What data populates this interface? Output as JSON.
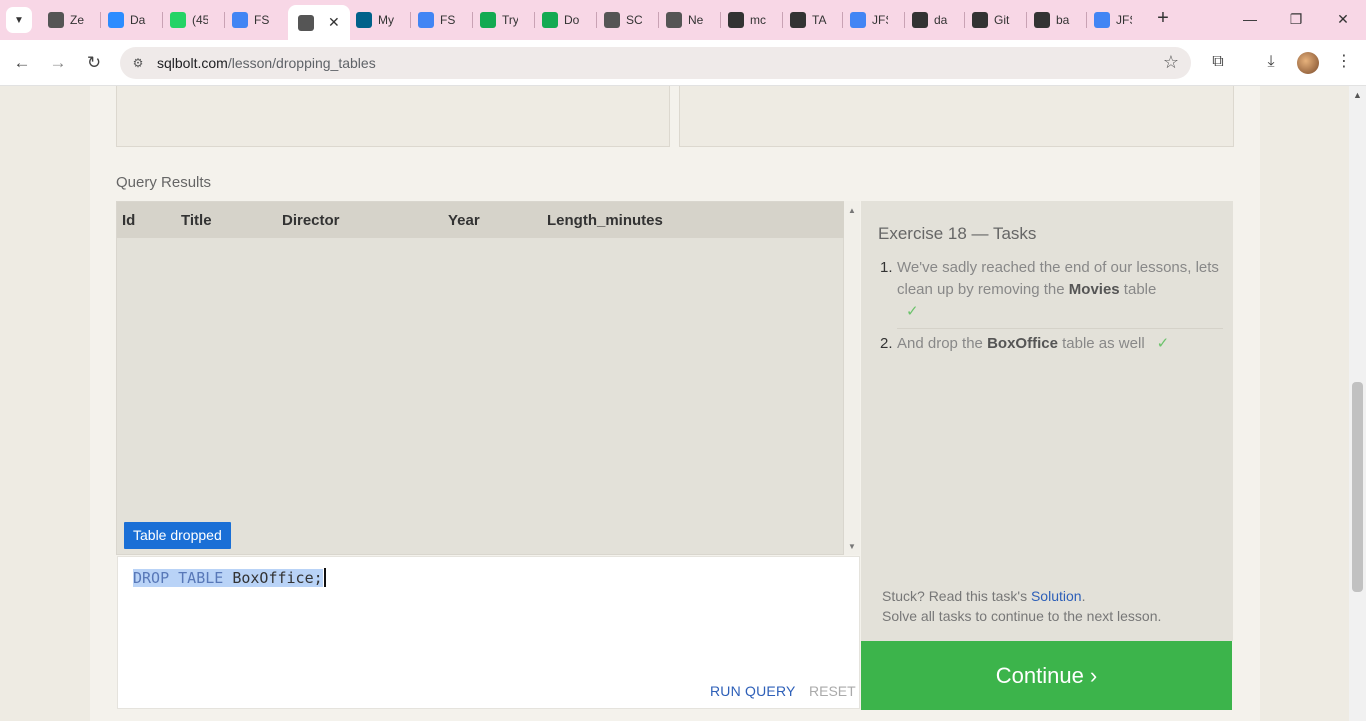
{
  "browser": {
    "tabs": [
      {
        "title": "Ze",
        "icon": "mail-icon",
        "color": "#555555"
      },
      {
        "title": "Da",
        "icon": "zoom-icon",
        "color": "#2d8cff"
      },
      {
        "title": "(45",
        "icon": "whatsapp-icon",
        "color": "#25d366"
      },
      {
        "title": "FSI",
        "icon": "docs-icon",
        "color": "#4285f4"
      },
      {
        "title": "",
        "icon": "database-icon",
        "color": "#555555",
        "active": true
      },
      {
        "title": "My",
        "icon": "mysql-icon",
        "color": "#00618a"
      },
      {
        "title": "FSI",
        "icon": "docs-icon",
        "color": "#4285f4"
      },
      {
        "title": "Try",
        "icon": "mongodb-icon",
        "color": "#13aa52"
      },
      {
        "title": "Do",
        "icon": "mongodb-icon",
        "color": "#13aa52"
      },
      {
        "title": "SC",
        "icon": "database-icon",
        "color": "#555555"
      },
      {
        "title": "Ne",
        "icon": "chrome-icon",
        "color": "#555555"
      },
      {
        "title": "mc",
        "icon": "github-icon",
        "color": "#333333"
      },
      {
        "title": "TA",
        "icon": "github-icon",
        "color": "#333333"
      },
      {
        "title": "JFS",
        "icon": "docs-icon",
        "color": "#4285f4"
      },
      {
        "title": "da",
        "icon": "github-icon",
        "color": "#333333"
      },
      {
        "title": "Git",
        "icon": "github-icon",
        "color": "#333333"
      },
      {
        "title": "ba",
        "icon": "github-icon",
        "color": "#333333"
      },
      {
        "title": "JFS",
        "icon": "docs-icon",
        "color": "#4285f4"
      }
    ],
    "url_domain": "sqlbolt.com",
    "url_path": "/lesson/dropping_tables"
  },
  "results": {
    "label": "Query Results",
    "columns": [
      "Id",
      "Title",
      "Director",
      "Year",
      "Length_minutes"
    ],
    "status_badge": "Table dropped"
  },
  "editor": {
    "kw1": "DROP",
    "kw2": "TABLE",
    "ident": "BoxOffice;",
    "run_label": "RUN QUERY",
    "reset_label": "RESET"
  },
  "tasks": {
    "title": "Exercise 18 — Tasks",
    "items": [
      {
        "num": "1.",
        "pre": "We've sadly reached the end of our lessons, lets clean up by removing the ",
        "bold": "Movies",
        "post": " table",
        "check": "✓"
      },
      {
        "num": "2.",
        "pre": "And drop the ",
        "bold": "BoxOffice",
        "post": " table as well",
        "check": "✓"
      }
    ],
    "stuck_pre": "Stuck? Read this task's ",
    "solution_link": "Solution",
    "stuck_post": ".",
    "solve_all": "Solve all tasks to continue to the next lesson.",
    "continue_label": "Continue ›"
  }
}
